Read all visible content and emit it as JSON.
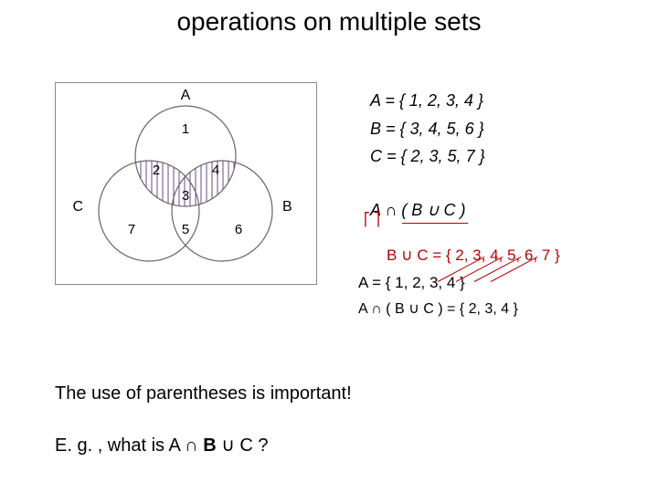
{
  "title": "operations on multiple sets",
  "venn": {
    "labelA": "A",
    "labelB": "B",
    "labelC": "C",
    "n1": "1",
    "n2": "2",
    "n3": "3",
    "n4": "4",
    "n5": "5",
    "n6": "6",
    "n7": "7"
  },
  "sets": {
    "A": "A = {  1, 2, 3, 4  }",
    "B": "B = {  3, 4, 5, 6  }",
    "C": "C = {  2, 3, 5, 7  }"
  },
  "operation": {
    "expr": "A ∩ ( B ∪ C )",
    "bracket": "⎡  ⎤"
  },
  "results": {
    "buc": "B ∪ C  = { 2, 3, 4, 5, 6, 7 }",
    "a_recall": "A = {  1, 2, 3, 4  }",
    "final": "A ∩ ( B ∪ C ) = { 2, 3, 4 }"
  },
  "footer": {
    "line1": "The use of parentheses is important!",
    "line2_pre": "E. g. , what is  A ",
    "line2_mid": "∩",
    "line2_b": " B ",
    "line2_cup": "∪",
    "line2_post": " C  ?"
  }
}
